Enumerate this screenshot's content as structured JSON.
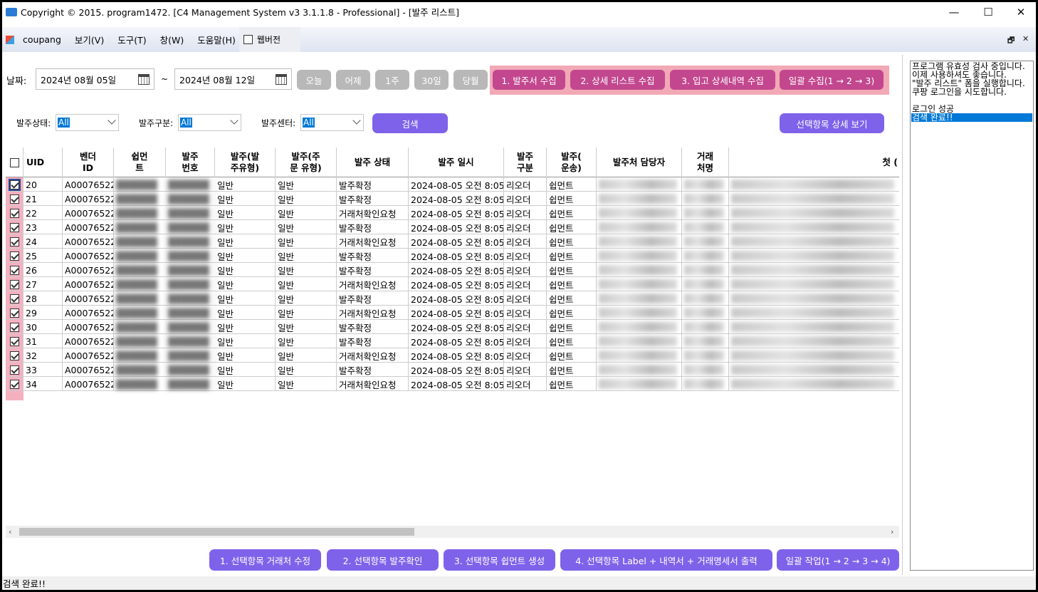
{
  "window": {
    "title": "Copyright © 2015. program1472. [C4 Management System v3 3.1.1.8 - Professional] - [발주 리스트]",
    "minimize": "—",
    "maximize": "☐",
    "close": "✕"
  },
  "menu": {
    "items": [
      "coupang",
      "보기(V)",
      "도구(T)",
      "창(W)",
      "도움말(H)"
    ],
    "web_version": "웹버전",
    "mdi_restore": "🗗",
    "mdi_close": "✕"
  },
  "filters": {
    "date_label": "날짜:",
    "date_from": "2024년 08월 05일",
    "date_sep": "~",
    "date_to": "2024년 08월 12일",
    "quick_buttons": [
      "오늘",
      "어제",
      "1주",
      "30일",
      "당월"
    ],
    "collect_buttons": [
      "1. 발주서 수집",
      "2. 상세 리스트 수집",
      "3. 입고 상세내역 수집",
      "일괄 수집(1 → 2 → 3)"
    ],
    "status_label": "발주상태:",
    "status_value": "All",
    "type_label": "발주구분:",
    "type_value": "All",
    "center_label": "발주센터:",
    "center_value": "All",
    "search_button": "검색",
    "detail_button": "선택항목 상세 보기"
  },
  "table": {
    "headers": [
      "UID",
      "벤더\nID",
      "쉽먼\n트",
      "발주\n번호",
      "발주(발\n주유형)",
      "발주(주\n문 유형)",
      "발주 상태",
      "발주 일시",
      "발주\n구분",
      "발주(\n운송)",
      "발주처 담당자",
      "거래\n처명",
      "첫 ("
    ],
    "rows": [
      {
        "uid": "20",
        "vendor": "A00076522",
        "shipment": "██████",
        "po": "██████",
        "po_type": "일반",
        "order_type": "일반",
        "status": "발주확정",
        "datetime": "2024-08-05 오전 8:05",
        "division": "리오더",
        "transport": "쉽먼트"
      },
      {
        "uid": "21",
        "vendor": "A00076522",
        "shipment": "██████",
        "po": "██████",
        "po_type": "일반",
        "order_type": "일반",
        "status": "발주확정",
        "datetime": "2024-08-05 오전 8:05",
        "division": "리오더",
        "transport": "쉽먼트"
      },
      {
        "uid": "22",
        "vendor": "A00076522",
        "shipment": "██████",
        "po": "██████",
        "po_type": "일반",
        "order_type": "일반",
        "status": "거래처확인요청",
        "datetime": "2024-08-05 오전 8:05",
        "division": "리오더",
        "transport": "쉽먼트"
      },
      {
        "uid": "23",
        "vendor": "A00076522",
        "shipment": "██████",
        "po": "██████",
        "po_type": "일반",
        "order_type": "일반",
        "status": "발주확정",
        "datetime": "2024-08-05 오전 8:05",
        "division": "리오더",
        "transport": "쉽먼트"
      },
      {
        "uid": "24",
        "vendor": "A00076522",
        "shipment": "██████",
        "po": "██████",
        "po_type": "일반",
        "order_type": "일반",
        "status": "거래처확인요청",
        "datetime": "2024-08-05 오전 8:05",
        "division": "리오더",
        "transport": "쉽먼트"
      },
      {
        "uid": "25",
        "vendor": "A00076522",
        "shipment": "██████",
        "po": "██████",
        "po_type": "일반",
        "order_type": "일반",
        "status": "발주확정",
        "datetime": "2024-08-05 오전 8:05",
        "division": "리오더",
        "transport": "쉽먼트"
      },
      {
        "uid": "26",
        "vendor": "A00076522",
        "shipment": "██████",
        "po": "██████",
        "po_type": "일반",
        "order_type": "일반",
        "status": "발주확정",
        "datetime": "2024-08-05 오전 8:05",
        "division": "리오더",
        "transport": "쉽먼트"
      },
      {
        "uid": "27",
        "vendor": "A00076522",
        "shipment": "██████",
        "po": "██████",
        "po_type": "일반",
        "order_type": "일반",
        "status": "거래처확인요청",
        "datetime": "2024-08-05 오전 8:05",
        "division": "리오더",
        "transport": "쉽먼트"
      },
      {
        "uid": "28",
        "vendor": "A00076522",
        "shipment": "██████",
        "po": "██████",
        "po_type": "일반",
        "order_type": "일반",
        "status": "발주확정",
        "datetime": "2024-08-05 오전 8:05",
        "division": "리오더",
        "transport": "쉽먼트"
      },
      {
        "uid": "29",
        "vendor": "A00076522",
        "shipment": "██████",
        "po": "██████",
        "po_type": "일반",
        "order_type": "일반",
        "status": "거래처확인요청",
        "datetime": "2024-08-05 오전 8:05",
        "division": "리오더",
        "transport": "쉽먼트"
      },
      {
        "uid": "30",
        "vendor": "A00076522",
        "shipment": "██████",
        "po": "██████",
        "po_type": "일반",
        "order_type": "일반",
        "status": "발주확정",
        "datetime": "2024-08-05 오전 8:05",
        "division": "리오더",
        "transport": "쉽먼트"
      },
      {
        "uid": "31",
        "vendor": "A00076522",
        "shipment": "██████",
        "po": "██████",
        "po_type": "일반",
        "order_type": "일반",
        "status": "발주확정",
        "datetime": "2024-08-05 오전 8:05",
        "division": "리오더",
        "transport": "쉽먼트"
      },
      {
        "uid": "32",
        "vendor": "A00076522",
        "shipment": "██████",
        "po": "██████",
        "po_type": "일반",
        "order_type": "일반",
        "status": "거래처확인요청",
        "datetime": "2024-08-05 오전 8:05",
        "division": "리오더",
        "transport": "쉽먼트"
      },
      {
        "uid": "33",
        "vendor": "A00076522",
        "shipment": "██████",
        "po": "██████",
        "po_type": "일반",
        "order_type": "일반",
        "status": "발주확정",
        "datetime": "2024-08-05 오전 8:05",
        "division": "리오더",
        "transport": "쉽먼트"
      },
      {
        "uid": "34",
        "vendor": "A00076522",
        "shipment": "██████",
        "po": "██████",
        "po_type": "일반",
        "order_type": "일반",
        "status": "거래처확인요청",
        "datetime": "2024-08-05 오전 8:05",
        "division": "리오더",
        "transport": "쉽먼트"
      }
    ]
  },
  "actions": [
    "1. 선택항목 거래처 수정",
    "2. 선택항목 발주확인",
    "3. 선택항목 쉽먼트 생성",
    "4. 선택항목 Label + 내역서 + 거래명세서 출력",
    "일괄 작업(1 → 2 → 3 → 4)"
  ],
  "log": {
    "lines": [
      "프로그램 유효성 검사 중입니다.",
      "이제 사용하셔도 좋습니다.",
      "\"발주 리스트\" 폼을 실행합니다.",
      "쿠팡 로그인을 시도합니다.",
      "",
      "로그인 성공",
      "검색 완료!!"
    ],
    "selected_index": 6
  },
  "status_bar": {
    "text": "검색 완료!!"
  },
  "colors": {
    "accent_purple": "#7f62ea",
    "collect_magenta": "#c2478f",
    "highlight_pink": "#f2a9b6",
    "selection_blue": "#0078d7"
  }
}
